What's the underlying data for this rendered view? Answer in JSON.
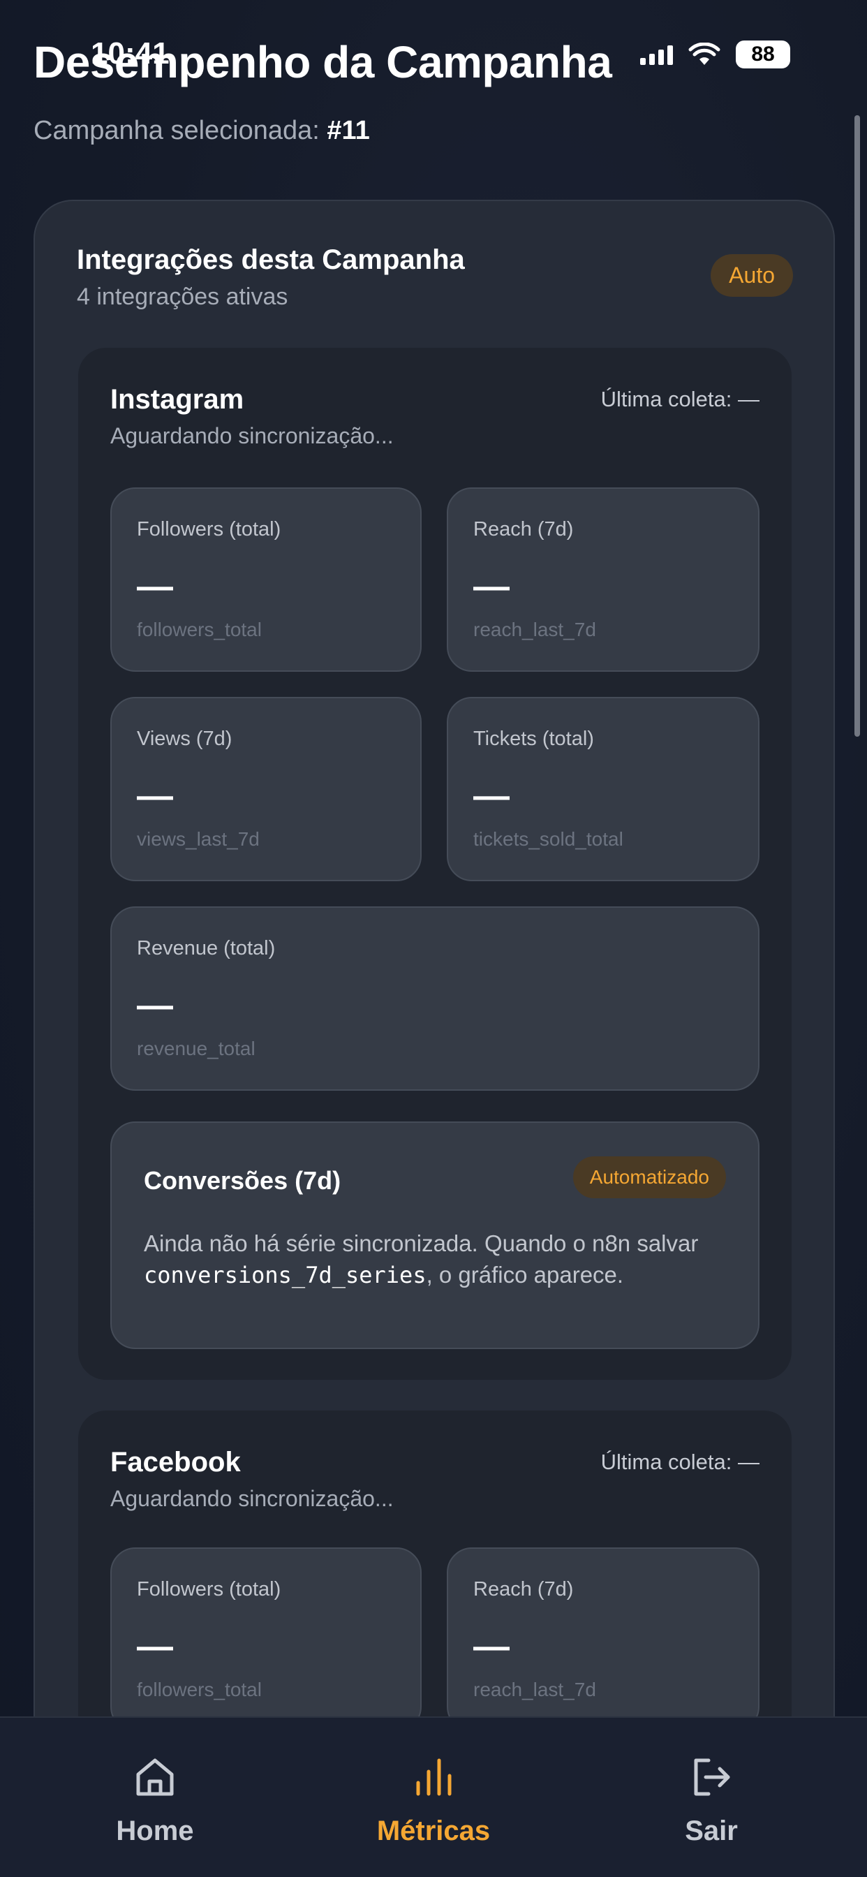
{
  "status_bar": {
    "time": "10:41",
    "battery": "88"
  },
  "header": {
    "title": "Desempenho da Campanha",
    "subtitle_prefix": "Campanha selecionada: ",
    "campaign_id": "#11"
  },
  "integrations_card": {
    "title": "Integrações desta Campanha",
    "subtitle": "4 integrações ativas",
    "badge": "Auto"
  },
  "instagram": {
    "name": "Instagram",
    "last_collect": "Última coleta: —",
    "status": "Aguardando sincronização...",
    "metrics": [
      {
        "label": "Followers (total)",
        "value": "—",
        "key": "followers_total"
      },
      {
        "label": "Reach (7d)",
        "value": "—",
        "key": "reach_last_7d"
      },
      {
        "label": "Views (7d)",
        "value": "—",
        "key": "views_last_7d"
      },
      {
        "label": "Tickets (total)",
        "value": "—",
        "key": "tickets_sold_total"
      },
      {
        "label": "Revenue (total)",
        "value": "—",
        "key": "revenue_total"
      }
    ],
    "conversions": {
      "title": "Conversões (7d)",
      "badge": "Automatizado",
      "text_before": "Ainda não há série sincronizada. Quando o n8n salvar ",
      "code": "conversions_7d_series",
      "text_after": ", o gráfico aparece."
    }
  },
  "facebook": {
    "name": "Facebook",
    "last_collect": "Última coleta: —",
    "status": "Aguardando sincronização...",
    "metrics": [
      {
        "label": "Followers (total)",
        "value": "—",
        "key": "followers_total"
      },
      {
        "label": "Reach (7d)",
        "value": "—",
        "key": "reach_last_7d"
      }
    ]
  },
  "nav": {
    "home": "Home",
    "metrics": "Métricas",
    "logout": "Sair",
    "active_color": "#f5a733",
    "inactive_color": "#c8ccd4"
  }
}
